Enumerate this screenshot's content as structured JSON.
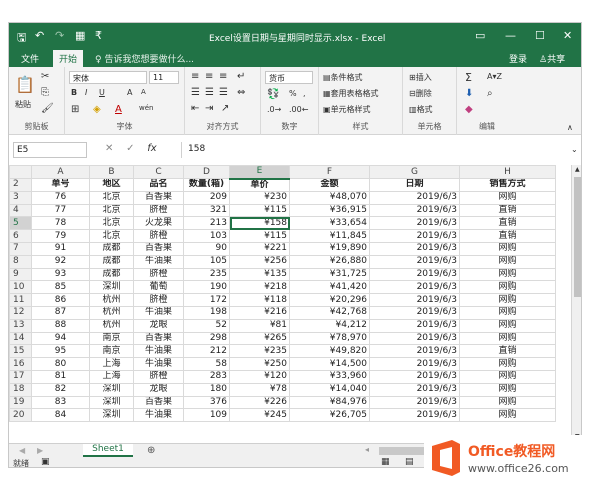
{
  "window": {
    "title": "Excel设置日期与星期同时显示.xlsx - Excel",
    "controls": [
      "▭",
      "—",
      "☐",
      "✕"
    ]
  },
  "menu": {
    "tabs": [
      "文件",
      "开始"
    ],
    "tell_me": "告诉我您想要做什么...",
    "login": "登录",
    "share": "共享"
  },
  "ribbon": {
    "clipboard": {
      "label": "剪贴板",
      "paste": "粘贴"
    },
    "font": {
      "label": "字体",
      "name": "宋体",
      "size": "11",
      "bold": "B",
      "italic": "I",
      "underline": "U",
      "grow": "A",
      "shrink": "A",
      "wen": "wén"
    },
    "alignment": {
      "label": "对齐方式"
    },
    "number": {
      "label": "数字",
      "format": "货币",
      "percent": "%"
    },
    "styles": {
      "label": "样式",
      "conditional": "条件格式",
      "table": "套用表格格式",
      "cell": "单元格样式"
    },
    "cells": {
      "label": "单元格",
      "insert": "插入",
      "delete": "删除",
      "format": "格式"
    },
    "editing": {
      "label": "编辑",
      "sum": "Σ",
      "sort": "A▾Z",
      "find": "⌕"
    }
  },
  "formula_bar": {
    "name_box": "E5",
    "fx": "fx",
    "content": "158"
  },
  "grid": {
    "columns": [
      "A",
      "B",
      "C",
      "D",
      "E",
      "F",
      "G",
      "H"
    ],
    "selected_column": "E",
    "selected_row": "5",
    "header_row": {
      "row": "2",
      "cells": [
        "单号",
        "地区",
        "品名",
        "数量(箱)",
        "单价",
        "金额",
        "日期",
        "销售方式"
      ]
    },
    "rows": [
      {
        "row": "3",
        "cells": [
          "76",
          "北京",
          "百香果",
          "209",
          "¥230",
          "¥48,070",
          "2019/6/3",
          "网购"
        ]
      },
      {
        "row": "4",
        "cells": [
          "77",
          "北京",
          "脐橙",
          "321",
          "¥115",
          "¥36,915",
          "2019/6/3",
          "直销"
        ]
      },
      {
        "row": "5",
        "cells": [
          "78",
          "北京",
          "火龙果",
          "213",
          "¥158",
          "¥33,654",
          "2019/6/3",
          "直销"
        ]
      },
      {
        "row": "6",
        "cells": [
          "79",
          "北京",
          "脐橙",
          "103",
          "¥115",
          "¥11,845",
          "2019/6/3",
          "直销"
        ]
      },
      {
        "row": "7",
        "cells": [
          "91",
          "成都",
          "百香果",
          "90",
          "¥221",
          "¥19,890",
          "2019/6/3",
          "网购"
        ]
      },
      {
        "row": "8",
        "cells": [
          "92",
          "成都",
          "牛油果",
          "105",
          "¥256",
          "¥26,880",
          "2019/6/3",
          "网购"
        ]
      },
      {
        "row": "9",
        "cells": [
          "93",
          "成都",
          "脐橙",
          "235",
          "¥135",
          "¥31,725",
          "2019/6/3",
          "网购"
        ]
      },
      {
        "row": "10",
        "cells": [
          "85",
          "深圳",
          "葡萄",
          "190",
          "¥218",
          "¥41,420",
          "2019/6/3",
          "网购"
        ]
      },
      {
        "row": "11",
        "cells": [
          "86",
          "杭州",
          "脐橙",
          "172",
          "¥118",
          "¥20,296",
          "2019/6/3",
          "网购"
        ]
      },
      {
        "row": "12",
        "cells": [
          "87",
          "杭州",
          "牛油果",
          "198",
          "¥216",
          "¥42,768",
          "2019/6/3",
          "网购"
        ]
      },
      {
        "row": "13",
        "cells": [
          "88",
          "杭州",
          "龙眼",
          "52",
          "¥81",
          "¥4,212",
          "2019/6/3",
          "网购"
        ]
      },
      {
        "row": "14",
        "cells": [
          "94",
          "南京",
          "百香果",
          "298",
          "¥265",
          "¥78,970",
          "2019/6/3",
          "网购"
        ]
      },
      {
        "row": "15",
        "cells": [
          "95",
          "南京",
          "牛油果",
          "212",
          "¥235",
          "¥49,820",
          "2019/6/3",
          "直销"
        ]
      },
      {
        "row": "16",
        "cells": [
          "80",
          "上海",
          "牛油果",
          "58",
          "¥250",
          "¥14,500",
          "2019/6/3",
          "网购"
        ]
      },
      {
        "row": "17",
        "cells": [
          "81",
          "上海",
          "脐橙",
          "283",
          "¥120",
          "¥33,960",
          "2019/6/3",
          "网购"
        ]
      },
      {
        "row": "18",
        "cells": [
          "82",
          "深圳",
          "龙眼",
          "180",
          "¥78",
          "¥14,040",
          "2019/6/3",
          "网购"
        ]
      },
      {
        "row": "19",
        "cells": [
          "83",
          "深圳",
          "百香果",
          "376",
          "¥226",
          "¥84,976",
          "2019/6/3",
          "网购"
        ]
      },
      {
        "row": "20",
        "cells": [
          "84",
          "深圳",
          "牛油果",
          "109",
          "¥245",
          "¥26,705",
          "2019/6/3",
          "网购"
        ]
      }
    ]
  },
  "sheets": {
    "active": "Sheet1",
    "add": "⊕"
  },
  "status": {
    "ready": "就绪"
  },
  "watermark": {
    "brand": "Office教程网",
    "url": "www.office26.com"
  },
  "colors": {
    "accent": "#217346",
    "logo_orange": "#f15a24"
  }
}
